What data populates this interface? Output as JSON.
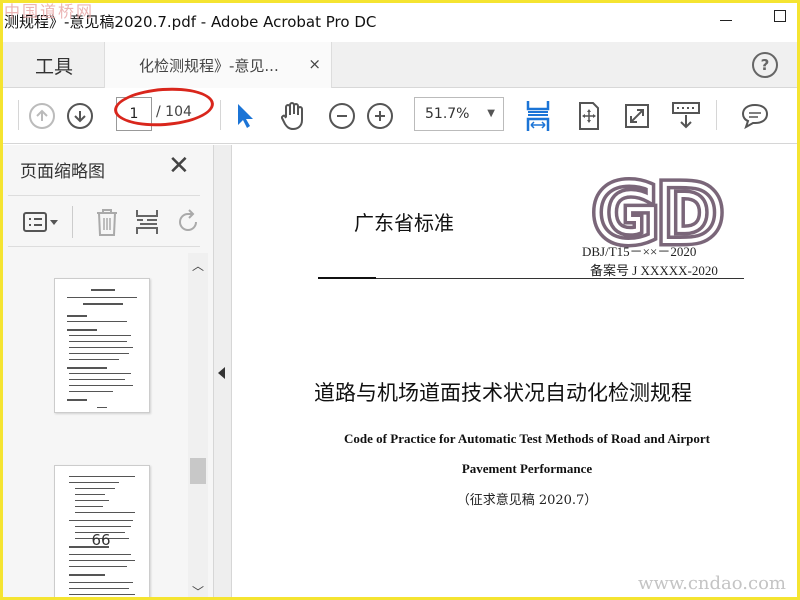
{
  "window": {
    "title": "测规程》-意见稿2020.7.pdf - Adobe Acrobat Pro DC"
  },
  "tabs": {
    "tools_label": "工具",
    "document_label": "化检测规程》-意见...",
    "close_glyph": "×",
    "help_glyph": "?"
  },
  "toolbar": {
    "current_page": "1",
    "total_pages": "/ 104",
    "zoom": "51.7%",
    "accent_color": "#1b74d6",
    "highlight_color": "#d9261c"
  },
  "sidebar": {
    "title": "页面缩略图",
    "thumbnail_page_label": "66"
  },
  "document": {
    "standard_label": "广东省标准",
    "logo_text": "GD",
    "code": "DBJ/T15－××－2020",
    "record_number": "备案号  J XXXXX-2020",
    "title_cn": "道路与机场道面技术状况自动化检测规程",
    "title_en_line1": "Code of Practice for Automatic Test Methods of Road and Airport",
    "title_en_line2": "Pavement Performance",
    "draft_note": "（征求意见稿 2020.7）"
  },
  "watermarks": {
    "top_left": "中国道桥网",
    "bottom_right": "www.cndao.com"
  },
  "colors": {
    "frame": "#f5e431",
    "logo": "#7a6679"
  }
}
